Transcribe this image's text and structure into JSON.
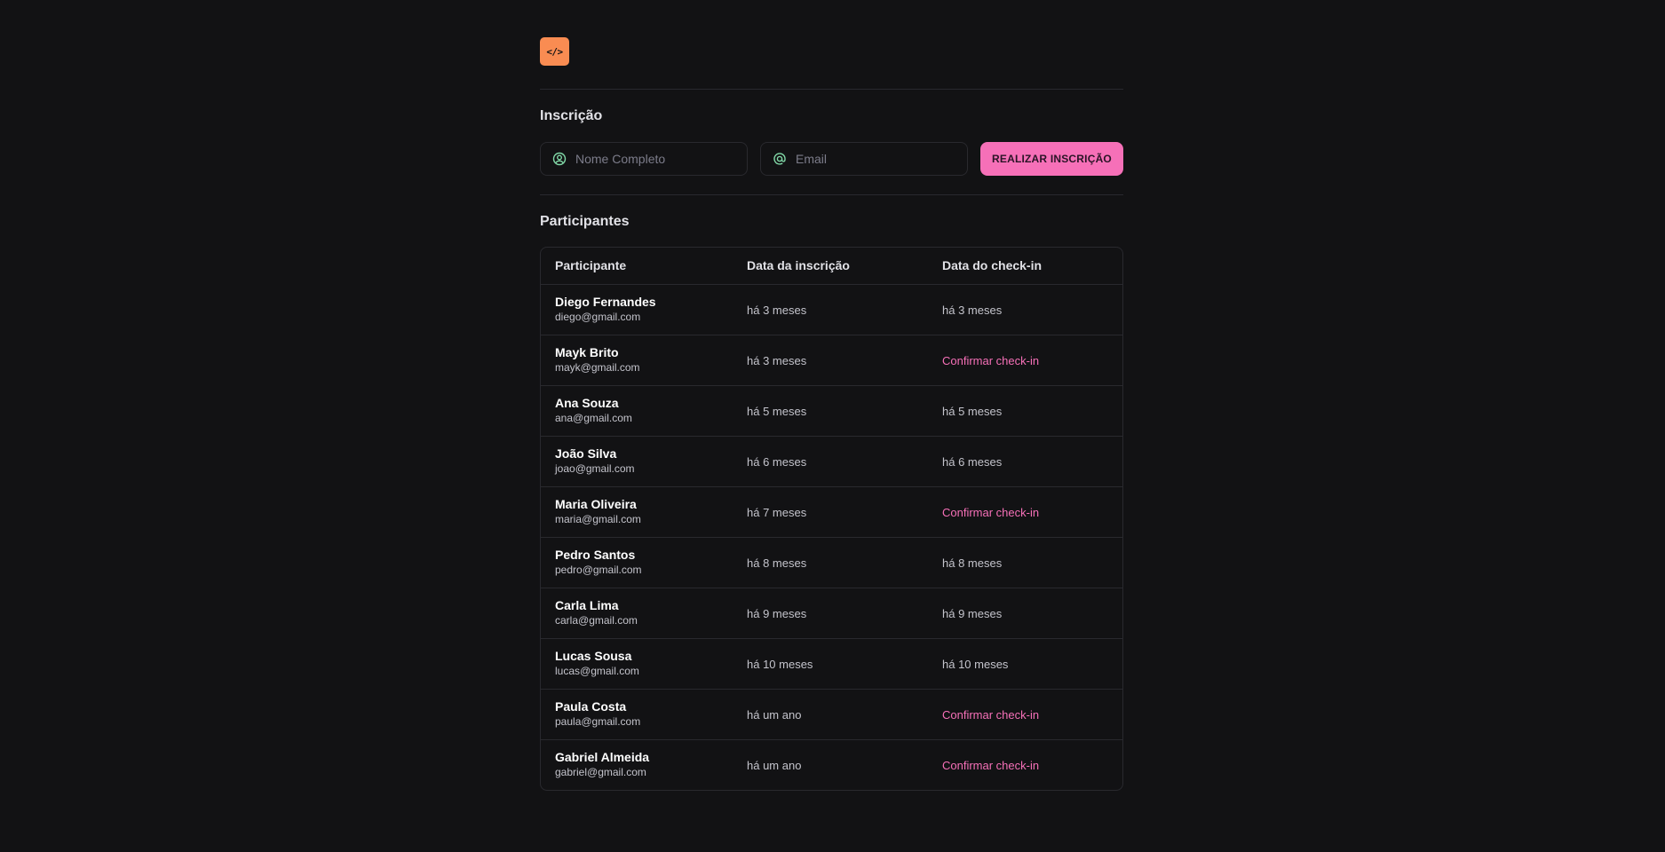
{
  "logo": {
    "text": "</>"
  },
  "registration": {
    "title": "Inscrição",
    "name_placeholder": "Nome Completo",
    "email_placeholder": "Email",
    "submit_label": "REALIZAR INSCRIÇÃO"
  },
  "participants": {
    "title": "Participantes",
    "columns": [
      "Participante",
      "Data da inscrição",
      "Data do check-in"
    ],
    "rows": [
      {
        "name": "Diego Fernandes",
        "email": "diego@gmail.com",
        "subscribed": "há 3 meses",
        "checkin": "há 3 meses",
        "checked_in": true
      },
      {
        "name": "Mayk Brito",
        "email": "mayk@gmail.com",
        "subscribed": "há 3 meses",
        "checkin": "Confirmar check-in",
        "checked_in": false
      },
      {
        "name": "Ana Souza",
        "email": "ana@gmail.com",
        "subscribed": "há 5 meses",
        "checkin": "há 5 meses",
        "checked_in": true
      },
      {
        "name": "João Silva",
        "email": "joao@gmail.com",
        "subscribed": "há 6 meses",
        "checkin": "há 6 meses",
        "checked_in": true
      },
      {
        "name": "Maria Oliveira",
        "email": "maria@gmail.com",
        "subscribed": "há 7 meses",
        "checkin": "Confirmar check-in",
        "checked_in": false
      },
      {
        "name": "Pedro Santos",
        "email": "pedro@gmail.com",
        "subscribed": "há 8 meses",
        "checkin": "há 8 meses",
        "checked_in": true
      },
      {
        "name": "Carla Lima",
        "email": "carla@gmail.com",
        "subscribed": "há 9 meses",
        "checkin": "há 9 meses",
        "checked_in": true
      },
      {
        "name": "Lucas Sousa",
        "email": "lucas@gmail.com",
        "subscribed": "há 10 meses",
        "checkin": "há 10 meses",
        "checked_in": true
      },
      {
        "name": "Paula Costa",
        "email": "paula@gmail.com",
        "subscribed": "há um ano",
        "checkin": "Confirmar check-in",
        "checked_in": false
      },
      {
        "name": "Gabriel Almeida",
        "email": "gabriel@gmail.com",
        "subscribed": "há um ano",
        "checkin": "Confirmar check-in",
        "checked_in": false
      }
    ]
  },
  "colors": {
    "background": "#121214",
    "accent_logo": "#f98c52",
    "accent_button": "#f670b8",
    "icon_green": "#81d8a7"
  },
  "icons": {
    "name_field": "user-circle-icon",
    "email_field": "at-sign-icon"
  }
}
